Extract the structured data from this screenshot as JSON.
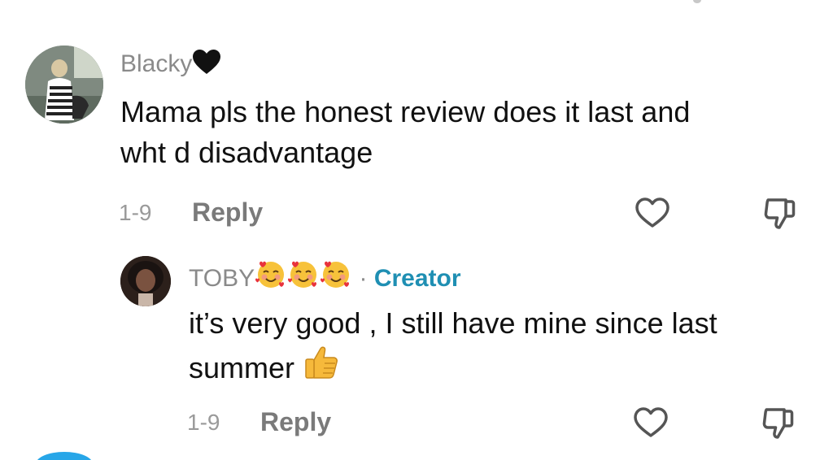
{
  "comments": [
    {
      "username": "Blacky",
      "username_emoji": "black-heart-icon",
      "text_line1": "Mama pls the honest review does it last and",
      "text_line2": "wht d disadvantage",
      "date": "1-9",
      "reply_label": "Reply",
      "replies": [
        {
          "username": "TOBY",
          "username_emojis": [
            "smiling-face-with-hearts-icon",
            "smiling-face-with-hearts-icon",
            "smiling-face-with-hearts-icon"
          ],
          "separator": "·",
          "badge": "Creator",
          "text_line1": "it’s very good , I still have mine since last",
          "text_line2": "summer",
          "text_emoji": "thumbs-up-icon",
          "date": "1-9",
          "reply_label": "Reply"
        }
      ]
    }
  ],
  "colors": {
    "username": "#8a8a8a",
    "creator_badge": "#1f8fb3",
    "comment_text": "#111111",
    "meta": "#9a9a9a",
    "icon_stroke": "#555555"
  }
}
